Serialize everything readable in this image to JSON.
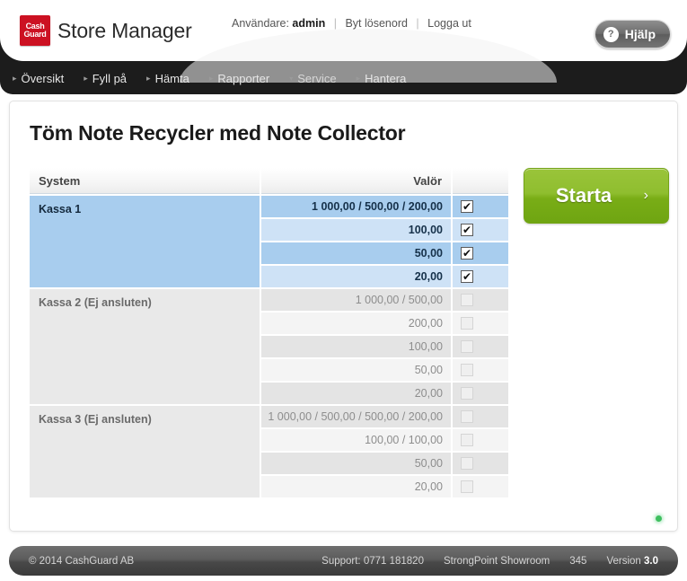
{
  "header": {
    "logo_line1": "Cash",
    "logo_line2": "Guard",
    "app_title": "Store Manager",
    "user_label": "Användare:",
    "user_name": "admin",
    "change_password": "Byt lösenord",
    "logout": "Logga ut",
    "help_label": "Hjälp",
    "help_icon_glyph": "?"
  },
  "nav": {
    "items": [
      {
        "label": "Översikt",
        "arrow": "▸",
        "active": false
      },
      {
        "label": "Fyll på",
        "arrow": "▸",
        "active": false
      },
      {
        "label": "Hämta",
        "arrow": "▸",
        "active": false
      },
      {
        "label": "Rapporter",
        "arrow": "▸",
        "active": false
      },
      {
        "label": "Service",
        "arrow": "▾",
        "active": true
      },
      {
        "label": "Hantera",
        "arrow": "▸",
        "active": false
      }
    ]
  },
  "main": {
    "page_title": "Töm Note Recycler med Note Collector",
    "columns": {
      "system": "System",
      "denomination": "Valör",
      "checkbox": ""
    },
    "groups": [
      {
        "name": "Kassa 1",
        "enabled": true,
        "rows": [
          {
            "value": "1 000,00 / 500,00 / 200,00",
            "checked": true
          },
          {
            "value": "100,00",
            "checked": true
          },
          {
            "value": "50,00",
            "checked": true
          },
          {
            "value": "20,00",
            "checked": true
          }
        ]
      },
      {
        "name": "Kassa 2 (Ej ansluten)",
        "enabled": false,
        "rows": [
          {
            "value": "1 000,00 / 500,00",
            "checked": false
          },
          {
            "value": "200,00",
            "checked": false
          },
          {
            "value": "100,00",
            "checked": false
          },
          {
            "value": "50,00",
            "checked": false
          },
          {
            "value": "20,00",
            "checked": false
          }
        ]
      },
      {
        "name": "Kassa 3 (Ej ansluten)",
        "enabled": false,
        "rows": [
          {
            "value": "1 000,00 / 500,00 / 500,00 / 200,00",
            "checked": false
          },
          {
            "value": "100,00 / 100,00",
            "checked": false
          },
          {
            "value": "50,00",
            "checked": false
          },
          {
            "value": "20,00",
            "checked": false
          }
        ]
      }
    ],
    "start_button": {
      "label": "Starta",
      "chevron": "›"
    },
    "status_dot_color": "#3fbf5f"
  },
  "footer": {
    "copyright": "© 2014 CashGuard AB",
    "copyright_brand": "CashGuard AB",
    "support": "Support: 0771 181820",
    "store": "StrongPoint Showroom",
    "store_number": "345",
    "version_label": "Version",
    "version_value": "3.0"
  },
  "colors": {
    "accent_green": "#8fbe2f",
    "brand_red": "#cc1122",
    "selected_blue": "#a8cdee",
    "selected_blue_alt": "#cee2f6"
  }
}
